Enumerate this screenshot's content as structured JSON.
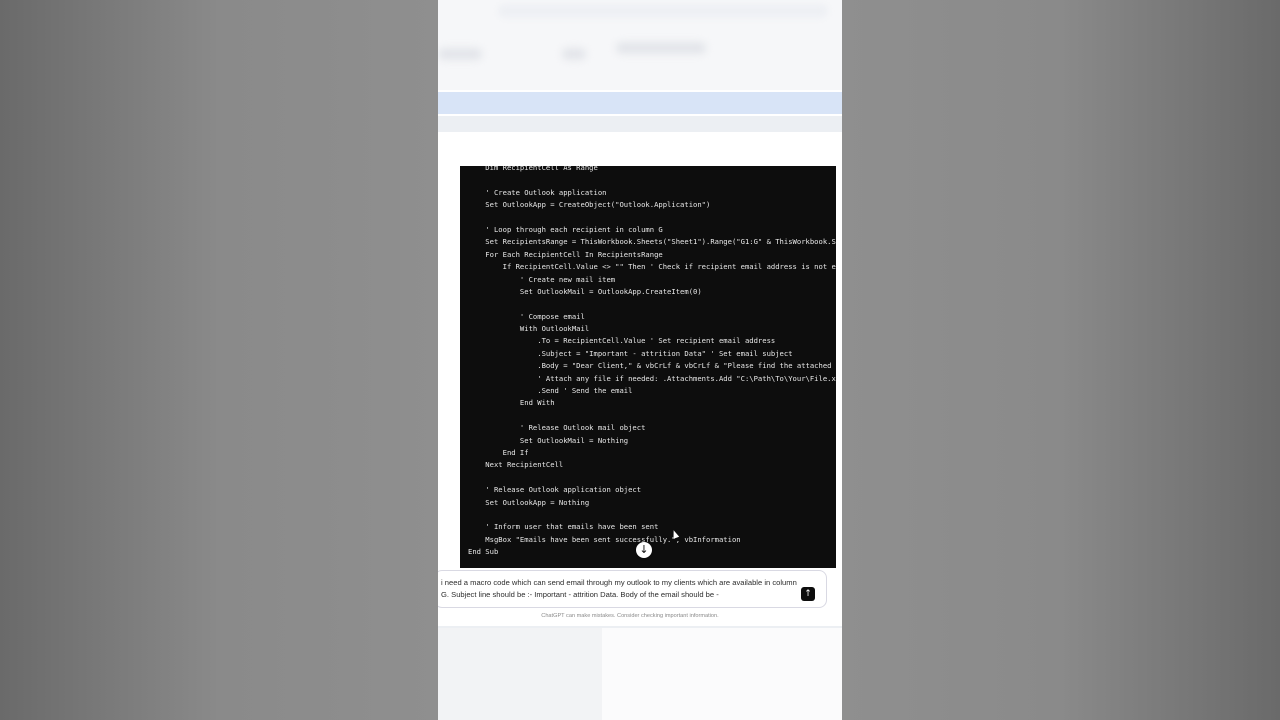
{
  "code": {
    "lines": [
      "    Dim RecipientCell As Range",
      "",
      "    ' Create Outlook application",
      "    Set OutlookApp = CreateObject(\"Outlook.Application\")",
      "",
      "    ' Loop through each recipient in column G",
      "    Set RecipientsRange = ThisWorkbook.Sheets(\"Sheet1\").Range(\"G1:G\" & ThisWorkbook.S",
      "    For Each RecipientCell In RecipientsRange",
      "        If RecipientCell.Value <> \"\" Then ' Check if recipient email address is not e",
      "            ' Create new mail item",
      "            Set OutlookMail = OutlookApp.CreateItem(0)",
      "",
      "            ' Compose email",
      "            With OutlookMail",
      "                .To = RecipientCell.Value ' Set recipient email address",
      "                .Subject = \"Important - attrition Data\" ' Set email subject",
      "                .Body = \"Dear Client,\" & vbCrLf & vbCrLf & \"Please find the attached",
      "                ' Attach any file if needed: .Attachments.Add \"C:\\Path\\To\\Your\\File.x",
      "                .Send ' Send the email",
      "            End With",
      "",
      "            ' Release Outlook mail object",
      "            Set OutlookMail = Nothing",
      "        End If",
      "    Next RecipientCell",
      "",
      "    ' Release Outlook application object",
      "    Set OutlookApp = Nothing",
      "",
      "    ' Inform user that emails have been sent",
      "    MsgBox \"Emails have been sent successfully.\", vbInformation",
      "End Sub"
    ]
  },
  "composer": {
    "text": "i need a macro code which can send email through my outlook to my clients which are available in column G. Subject line should be :- Important - attrition Data. Body of the email should be -",
    "send_icon": "arrow-up-icon"
  },
  "scroll_icon": "arrow-down-icon",
  "footer": {
    "disclaimer": "ChatGPT can make mistakes. Consider checking important information."
  }
}
